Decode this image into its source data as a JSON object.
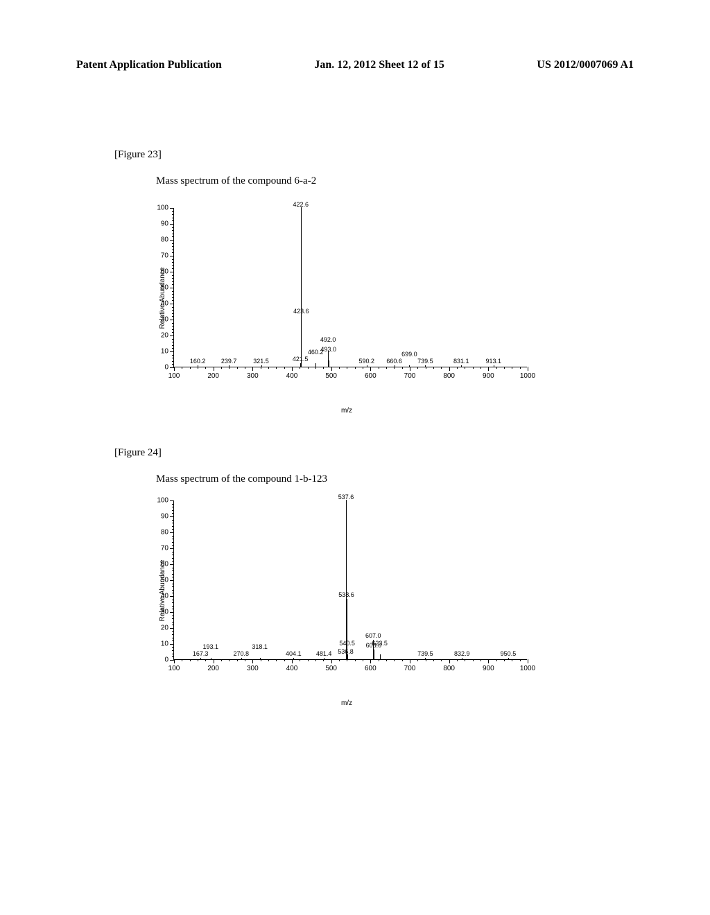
{
  "header": {
    "left": "Patent Application Publication",
    "center": "Jan. 12, 2012  Sheet 12 of 15",
    "right": "US 2012/0007069 A1"
  },
  "figure23": {
    "label": "[Figure 23]",
    "title": "Mass spectrum of the compound 6-a-2"
  },
  "figure24": {
    "label": "[Figure 24]",
    "title": "Mass spectrum of the compound 1-b-123"
  },
  "chart_data": [
    {
      "type": "bar",
      "title": "Mass spectrum of the compound 6-a-2",
      "xlabel": "m/z",
      "ylabel": "Relative Abundance",
      "xlim": [
        100,
        1000
      ],
      "ylim": [
        0,
        100
      ],
      "y_ticks": [
        0,
        10,
        20,
        30,
        40,
        50,
        60,
        70,
        80,
        90,
        100
      ],
      "x_ticks": [
        100,
        200,
        300,
        400,
        500,
        600,
        700,
        800,
        900,
        1000
      ],
      "peaks": [
        {
          "mz": 160.2,
          "abundance": 1
        },
        {
          "mz": 239.7,
          "abundance": 1
        },
        {
          "mz": 321.5,
          "abundance": 1
        },
        {
          "mz": 421.5,
          "abundance": 2
        },
        {
          "mz": 422.6,
          "abundance": 100
        },
        {
          "mz": 423.6,
          "abundance": 32
        },
        {
          "mz": 460.2,
          "abundance": 2
        },
        {
          "mz": 492.0,
          "abundance": 10
        },
        {
          "mz": 493.0,
          "abundance": 4
        },
        {
          "mz": 590.2,
          "abundance": 1
        },
        {
          "mz": 660.6,
          "abundance": 1
        },
        {
          "mz": 699.0,
          "abundance": 1
        },
        {
          "mz": 739.5,
          "abundance": 1
        },
        {
          "mz": 831.1,
          "abundance": 1
        },
        {
          "mz": 913.1,
          "abundance": 1
        }
      ]
    },
    {
      "type": "bar",
      "title": "Mass spectrum of the compound 1-b-123",
      "xlabel": "m/z",
      "ylabel": "Relative Abundance",
      "xlim": [
        100,
        1000
      ],
      "ylim": [
        0,
        100
      ],
      "y_ticks": [
        0,
        10,
        20,
        30,
        40,
        50,
        60,
        70,
        80,
        90,
        100
      ],
      "x_ticks": [
        100,
        200,
        300,
        400,
        500,
        600,
        700,
        800,
        900,
        1000
      ],
      "peaks": [
        {
          "mz": 167.3,
          "abundance": 1
        },
        {
          "mz": 193.1,
          "abundance": 1
        },
        {
          "mz": 270.8,
          "abundance": 1
        },
        {
          "mz": 318.1,
          "abundance": 1
        },
        {
          "mz": 404.1,
          "abundance": 1
        },
        {
          "mz": 481.4,
          "abundance": 1
        },
        {
          "mz": 536.8,
          "abundance": 2
        },
        {
          "mz": 537.6,
          "abundance": 100
        },
        {
          "mz": 538.6,
          "abundance": 38
        },
        {
          "mz": 540.5,
          "abundance": 3
        },
        {
          "mz": 607.0,
          "abundance": 12
        },
        {
          "mz": 608.0,
          "abundance": 6
        },
        {
          "mz": 623.5,
          "abundance": 3
        },
        {
          "mz": 739.5,
          "abundance": 1
        },
        {
          "mz": 832.9,
          "abundance": 1
        },
        {
          "mz": 950.5,
          "abundance": 1
        }
      ]
    }
  ]
}
